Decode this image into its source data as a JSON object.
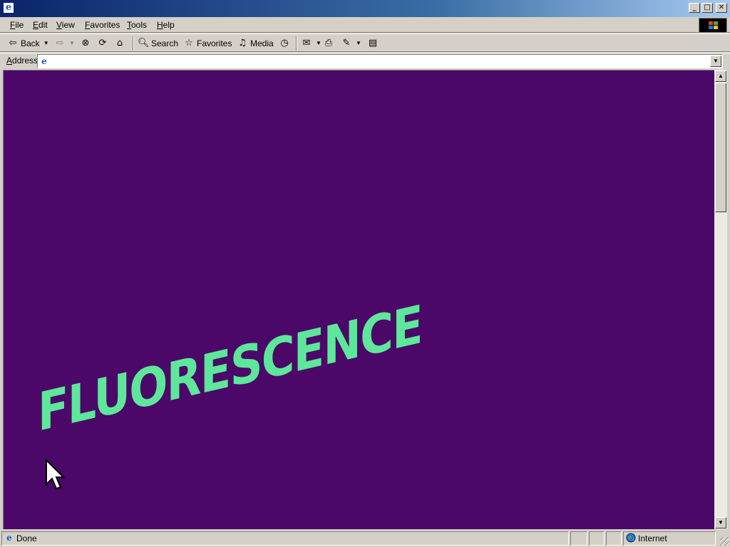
{
  "window": {
    "title": ""
  },
  "menu": [
    "File",
    "Edit",
    "View",
    "Favorites",
    "Tools",
    "Help"
  ],
  "toolbar": {
    "back_label": "Back",
    "search_label": "Search",
    "favorites_label": "Favorites",
    "media_label": "Media"
  },
  "address": {
    "label": "Address",
    "value": ""
  },
  "page": {
    "background": "#4b0868",
    "headline": "FLUORESCENCE",
    "headline_color": "#5ee79a"
  },
  "scrollbar": {
    "position_fraction": 0.0
  },
  "status": {
    "text": "Done",
    "zone": "Internet"
  }
}
